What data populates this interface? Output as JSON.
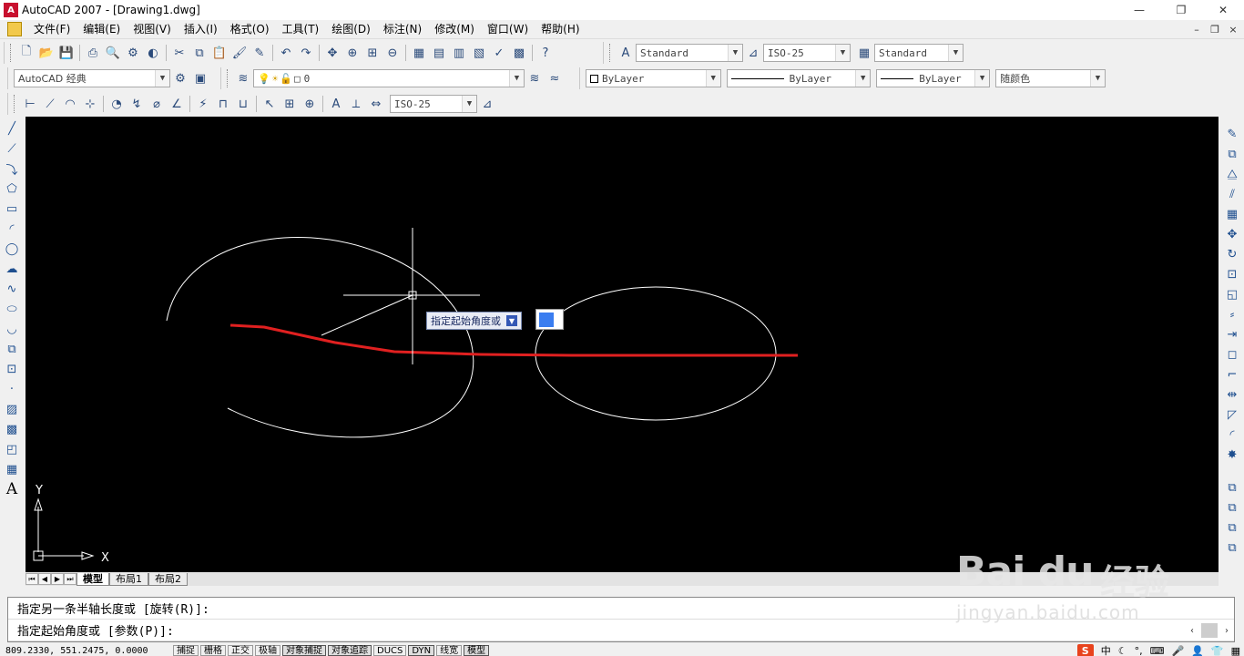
{
  "window": {
    "title": "AutoCAD 2007 - [Drawing1.dwg]",
    "icon": "autocad-app-icon",
    "controls": [
      "—",
      "❐",
      "✕"
    ],
    "doc_controls": [
      "–",
      "❐",
      "×"
    ]
  },
  "menu": {
    "items": [
      "文件(F)",
      "编辑(E)",
      "视图(V)",
      "插入(I)",
      "格式(O)",
      "工具(T)",
      "绘图(D)",
      "标注(N)",
      "修改(M)",
      "窗口(W)",
      "帮助(H)"
    ]
  },
  "toolbar_styles": {
    "text_style": "Standard",
    "dim_style": "ISO-25",
    "table_style": "Standard"
  },
  "toolbar_layers": {
    "workspace": "AutoCAD 经典",
    "layer": "0",
    "color": "ByLayer",
    "linetype": "ByLayer",
    "lineweight": "ByLayer",
    "plotstyle": "随颜色"
  },
  "toolbar_dimension": {
    "dim_style": "ISO-25"
  },
  "drawing": {
    "dynamic_prompt": "指定起始角度或",
    "ucs_x": "X",
    "ucs_y": "Y",
    "colors": {
      "background": "#000000",
      "entities": "#ffffff",
      "sketch_line": "#e02020",
      "crosshair": "#ffffff"
    }
  },
  "tabs": {
    "items": [
      "模型",
      "布局1",
      "布局2"
    ],
    "active": "模型"
  },
  "command": {
    "line1": "指定另一条半轴长度或 [旋转(R)]:",
    "line2": "指定起始角度或 [参数(P)]:"
  },
  "status": {
    "coords": "809.2330, 551.2475, 0.0000",
    "buttons": [
      "捕捉",
      "栅格",
      "正交",
      "极轴",
      "对象捕捉",
      "对象追踪",
      "DUCS",
      "DYN",
      "线宽",
      "模型"
    ],
    "active_buttons": [
      "对象捕捉",
      "对象追踪",
      "DYN",
      "模型"
    ]
  },
  "watermark": {
    "logo": "Bai du",
    "text": "经验",
    "url": "jingyan.baidu.com"
  },
  "tray": {
    "ime": "S",
    "lang": "中"
  }
}
